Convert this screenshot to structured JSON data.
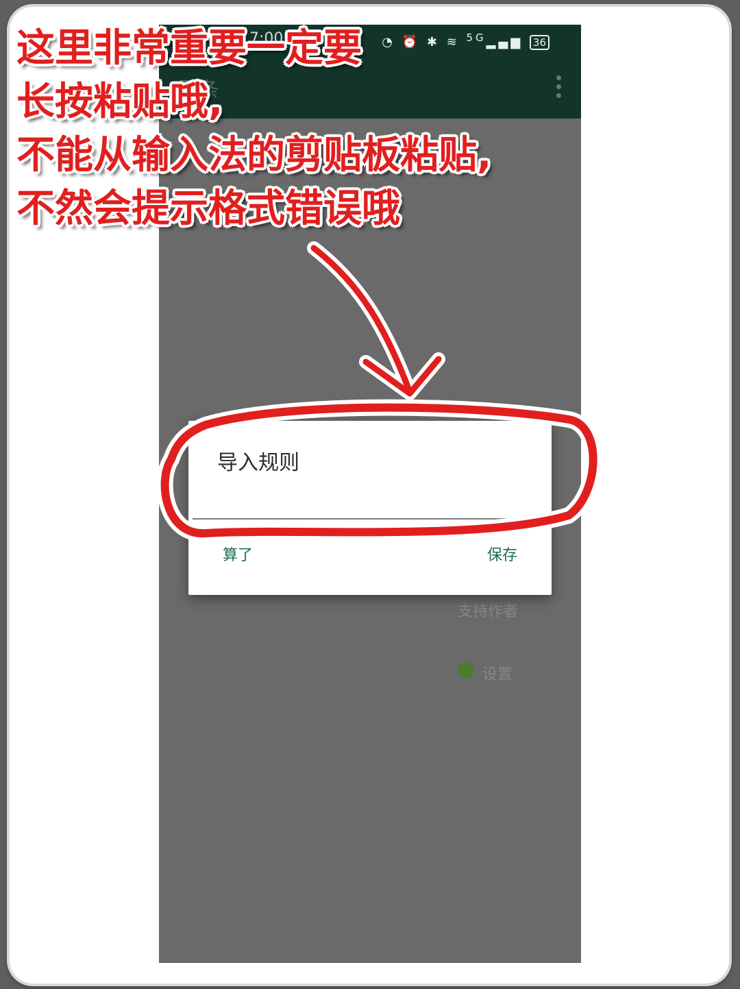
{
  "status_bar": {
    "time": "7:00",
    "icons": [
      "speed-icon",
      "alarm-icon",
      "bluetooth-icon",
      "wifi-icon",
      "signal-5g-icon"
    ],
    "network": "5G",
    "battery": "36"
  },
  "app_bar": {
    "title": "百条"
  },
  "background_menu": {
    "support_author": "支持作者",
    "settings": "设置"
  },
  "dialog": {
    "title": "导入规则",
    "input_value": "",
    "cancel_label": "算了",
    "save_label": "保存"
  },
  "annotation": {
    "lines": [
      "这里非常重要一定要",
      "长按粘贴哦,",
      "不能从输入法的剪贴板粘贴,",
      "不然会提示格式错误哦"
    ]
  },
  "colors": {
    "app_bar": "#13342b",
    "accent": "#1d6b56",
    "annotation": "#e11f1f",
    "scrim": "#6a6a6a"
  }
}
